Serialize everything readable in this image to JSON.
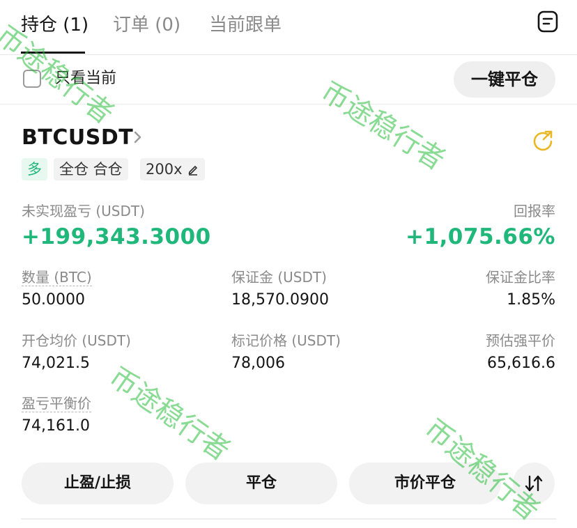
{
  "tabs": [
    {
      "label": "持仓",
      "count": "(1)"
    },
    {
      "label": "订单",
      "count": "(0)"
    },
    {
      "label": "当前跟单",
      "count": ""
    }
  ],
  "filter": {
    "checkbox_label": "只看当前",
    "close_all_label": "一键平仓"
  },
  "position": {
    "symbol": "BTCUSDT",
    "tags": {
      "side": "多",
      "mode": "全仓 合仓",
      "leverage": "200x"
    },
    "pnl_label": "未实现盈亏 (USDT)",
    "pnl_value": "+199,343.3000",
    "roe_label": "回报率",
    "roe_value": "+1,075.66%",
    "fields": {
      "qty_label": "数量 (BTC)",
      "qty_value": "50.0000",
      "margin_label": "保证金 (USDT)",
      "margin_value": "18,570.0900",
      "margin_ratio_label": "保证金比率",
      "margin_ratio_value": "1.85%",
      "entry_label": "开仓均价 (USDT)",
      "entry_value": "74,021.5",
      "mark_label": "标记价格 (USDT)",
      "mark_value": "78,006",
      "liq_label": "预估强平价",
      "liq_value": "65,616.6",
      "breakeven_label": "盈亏平衡价",
      "breakeven_value": "74,161.0"
    }
  },
  "actions": {
    "tpsl": "止盈/止损",
    "close": "平仓",
    "market_close": "市价平仓"
  },
  "watermark": "币途稳行者",
  "colors": {
    "profit_green": "#1fb77a",
    "watermark_green": "#28be3c",
    "text": "#141414",
    "muted": "#8a8a8a"
  }
}
